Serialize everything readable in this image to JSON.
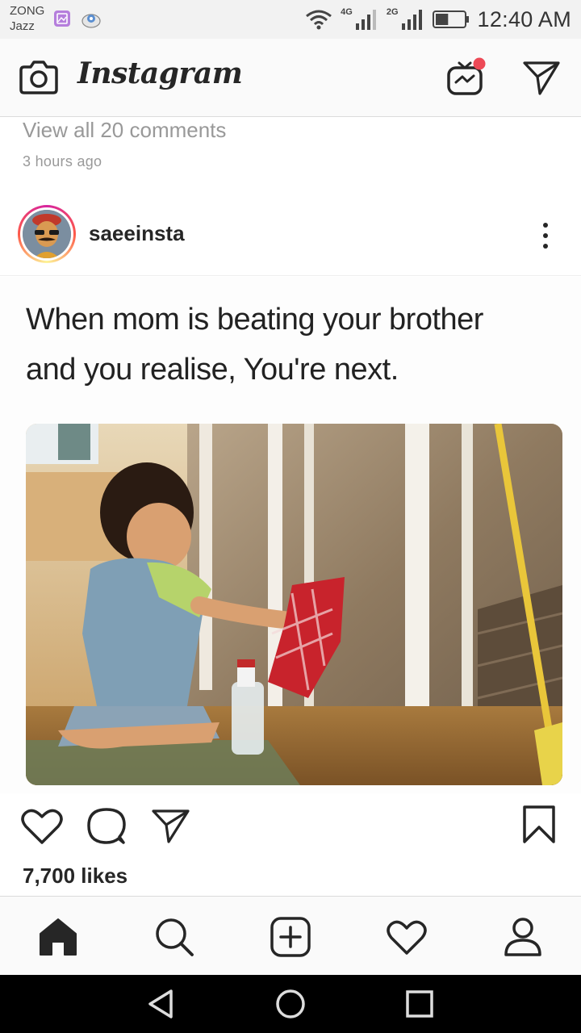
{
  "status_bar": {
    "carrier_line1": "ZONG",
    "carrier_line2": "Jazz",
    "network1": "4G",
    "network2": "2G",
    "time": "12:40 AM",
    "battery_level": 0.45
  },
  "header": {
    "brand": "Instagram",
    "icons": [
      "camera-icon",
      "igtv-icon",
      "direct-message-icon"
    ],
    "igtv_badge_color": "#ed4956"
  },
  "previous_post": {
    "view_comments": "View all 20 comments",
    "time_ago": "3 hours ago"
  },
  "post": {
    "username": "saeeinsta",
    "caption_line1": "When mom is beating your brother",
    "caption_line2": "and you realise, You're next.",
    "likes": "7,700 likes",
    "actions": [
      "heart-icon",
      "comment-icon",
      "share-icon",
      "bookmark-icon"
    ]
  },
  "bottom_nav": {
    "items": [
      "home-icon",
      "search-icon",
      "add-post-icon",
      "activity-icon",
      "profile-icon"
    ]
  },
  "system_nav": {
    "items": [
      "back-icon",
      "home-circle-icon",
      "recents-icon"
    ]
  }
}
